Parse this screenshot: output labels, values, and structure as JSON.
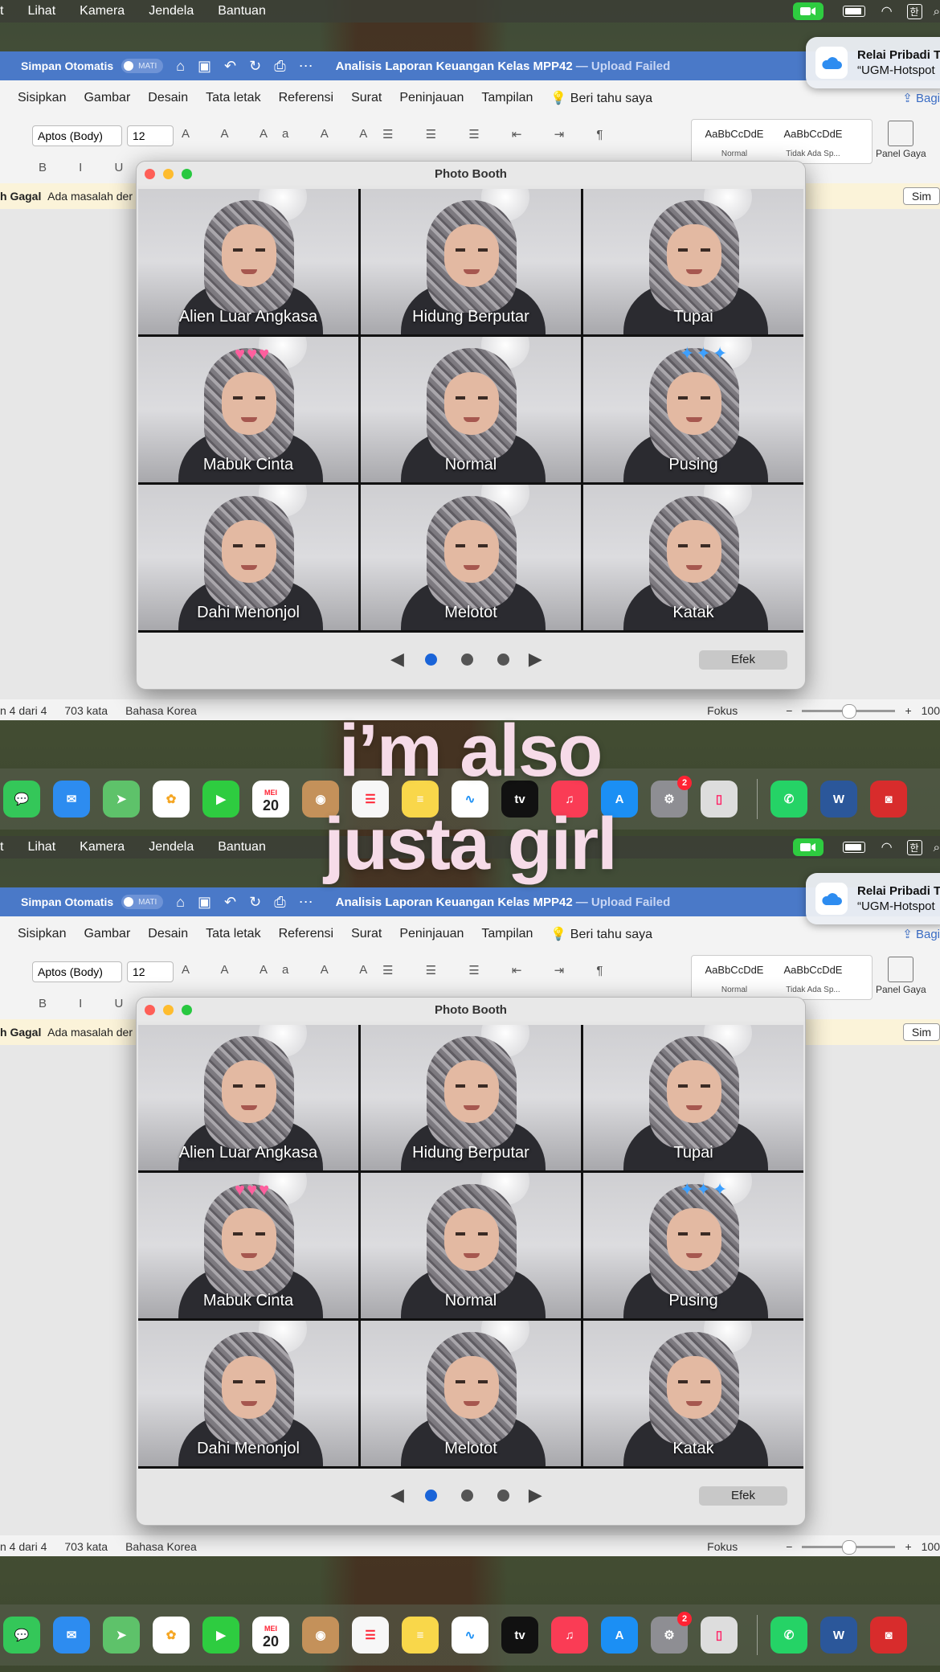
{
  "menubar": {
    "items": [
      "t",
      "Lihat",
      "Kamera",
      "Jendela",
      "Bantuan"
    ],
    "ime": "한"
  },
  "notification": {
    "title": "Relai Pribadi T",
    "subtitle": "“UGM-Hotspot"
  },
  "word": {
    "autosave_label": "Simpan Otomatis",
    "autosave_state": "MATI",
    "doc_title": "Analisis Laporan Keuangan Kelas MPP42",
    "doc_status": "— Upload Failed",
    "tabs": [
      "Sisipkan",
      "Gambar",
      "Desain",
      "Tata letak",
      "Referensi",
      "Surat",
      "Peninjauan",
      "Tampilan"
    ],
    "tell_me": "Beri tahu saya",
    "share": "Bagi",
    "font": "Aptos (Body)",
    "size": "12",
    "styles": [
      {
        "sample": "AaBbCcDdE",
        "name": "Normal"
      },
      {
        "sample": "AaBbCcDdE",
        "name": "Tidak Ada Sp..."
      }
    ],
    "styles_pane": "Panel Gaya",
    "message": {
      "title": "h Gagal",
      "text": "Ada masalah der",
      "button": "Sim"
    },
    "status": {
      "page": "n 4 dari 4",
      "words": "703 kata",
      "language": "Bahasa Korea",
      "focus": "Fokus",
      "zoom": "100"
    }
  },
  "photobooth": {
    "title": "Photo Booth",
    "effects_top": [
      "Alien Luar Angkasa",
      "Hidung Berputar",
      "Tupai",
      "Mabuk Cinta",
      "Normal",
      "Pusing",
      "Dahi Menonjol",
      "Melotot",
      "Katak"
    ],
    "effects_bottom": [
      "Alien Luar Angkasa",
      "Hidung Berputar",
      "Tupai",
      "Mabuk Cinta",
      "Normal",
      "Pusing",
      "Dahi Menonjol",
      "Melotot",
      "Katak"
    ],
    "effects_button": "Efek"
  },
  "caption": {
    "line1": "i’m also",
    "line2": "justa girl"
  },
  "dock": {
    "calendar_month": "MEI",
    "calendar_day": "20",
    "tv_label": "tv",
    "word_label": "W",
    "badge": "2",
    "apps": [
      {
        "name": "messages",
        "color": "#34c759"
      },
      {
        "name": "mail",
        "color": "#2d8cf0"
      },
      {
        "name": "maps",
        "color": "#5ec26a"
      },
      {
        "name": "photos",
        "color": "#f5a623"
      },
      {
        "name": "facetime",
        "color": "#2ecc40"
      },
      {
        "name": "calendar",
        "color": "#ffffff"
      },
      {
        "name": "contacts",
        "color": "#c4915a"
      },
      {
        "name": "reminders",
        "color": "#f7f7f7"
      },
      {
        "name": "notes",
        "color": "#f9d74a"
      },
      {
        "name": "freeform",
        "color": "#ffffff"
      },
      {
        "name": "tv",
        "color": "#111111"
      },
      {
        "name": "music",
        "color": "#fa3c55"
      },
      {
        "name": "app-store",
        "color": "#1b8ff4"
      },
      {
        "name": "system-settings",
        "color": "#8e8e93"
      },
      {
        "name": "iphone-mirroring",
        "color": "#dddddd"
      },
      {
        "name": "whatsapp",
        "color": "#25d366"
      },
      {
        "name": "word",
        "color": "#2b579a"
      },
      {
        "name": "photo-booth",
        "color": "#d82c2c"
      }
    ]
  }
}
